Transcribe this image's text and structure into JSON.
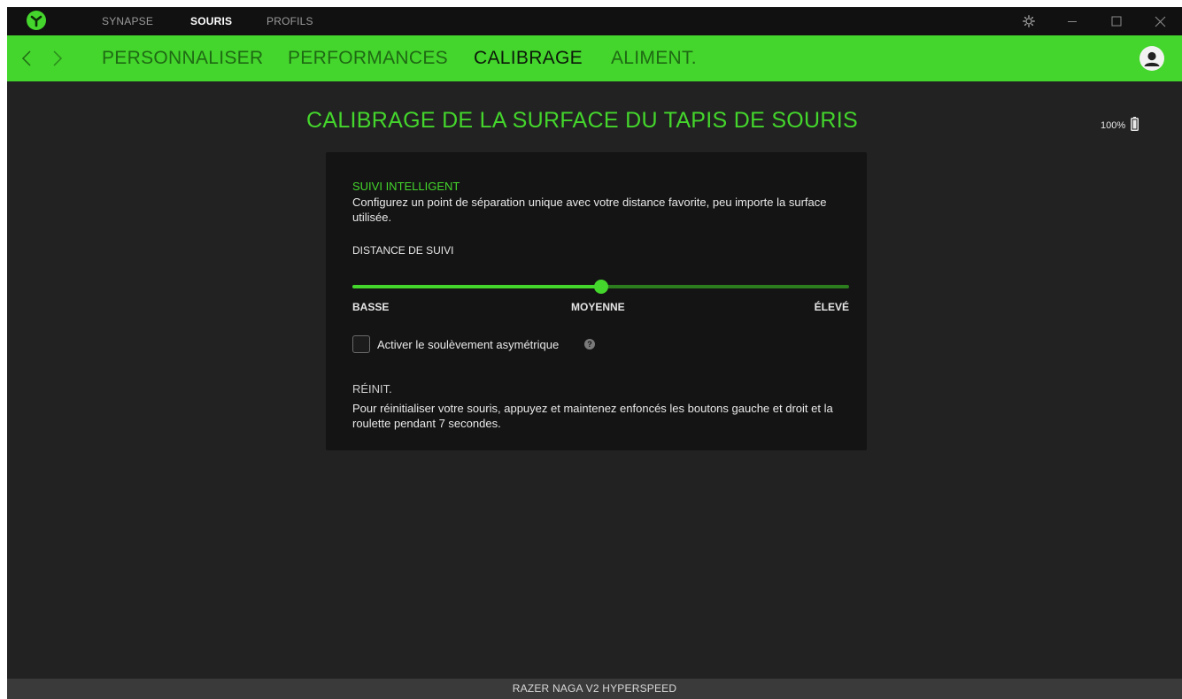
{
  "titlebar": {
    "tabs": [
      {
        "label": "SYNAPSE"
      },
      {
        "label": "SOURIS"
      },
      {
        "label": "PROFILS"
      }
    ]
  },
  "navbar": {
    "tabs": [
      {
        "label": "PERSONNALISER"
      },
      {
        "label": "PERFORMANCES"
      },
      {
        "label": "CALIBRAGE"
      },
      {
        "label": "ALIMENT."
      }
    ],
    "active_tab": "CALIBRAGE"
  },
  "main": {
    "title": "CALIBRAGE DE LA SURFACE DU TAPIS DE SOURIS",
    "battery": "100%"
  },
  "card": {
    "heading": "SUIVI INTELLIGENT",
    "description": "Configurez un point de séparation unique avec votre distance favorite, peu importe la surface utilisée.",
    "distance_label": "DISTANCE DE SUIVI",
    "slider": {
      "min_label": "BASSE",
      "mid_label": "MOYENNE",
      "max_label": "ÉLEVÉ",
      "value_fraction": 0.5
    },
    "checkbox": {
      "label": "Activer le soulèvement asymétrique",
      "checked": false
    },
    "reset_heading": "RÉINIT.",
    "reset_text": "Pour réinitialiser votre souris, appuyez et maintenez enfoncés les boutons gauche et droit et la roulette pendant 7 secondes."
  },
  "footer": {
    "device_name": "RAZER NAGA V2 HYPERSPEED"
  },
  "colors": {
    "accent": "#44d62c",
    "background": "#222222",
    "card": "#141414",
    "titlebar": "#111111"
  },
  "icons": [
    "razer-logo-icon",
    "settings-gear-icon",
    "minimize-icon",
    "maximize-icon",
    "close-icon",
    "back-arrow-icon",
    "forward-arrow-icon",
    "user-avatar-icon",
    "battery-icon",
    "help-icon"
  ]
}
